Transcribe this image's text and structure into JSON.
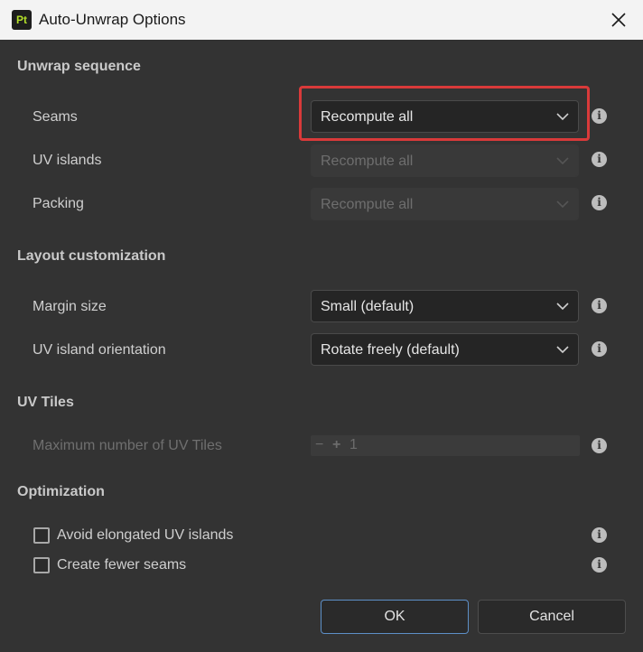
{
  "window": {
    "title": "Auto-Unwrap Options",
    "app_icon_text": "Pt"
  },
  "sections": {
    "unwrap": {
      "title": "Unwrap sequence",
      "seams": {
        "label": "Seams",
        "value": "Recompute all"
      },
      "uv_islands": {
        "label": "UV islands",
        "value": "Recompute all"
      },
      "packing": {
        "label": "Packing",
        "value": "Recompute all"
      }
    },
    "layout": {
      "title": "Layout customization",
      "margin": {
        "label": "Margin size",
        "value": "Small (default)"
      },
      "orientation": {
        "label": "UV island orientation",
        "value": "Rotate freely (default)"
      }
    },
    "uv_tiles": {
      "title": "UV Tiles",
      "max_tiles": {
        "label": "Maximum number of UV Tiles",
        "minus": "−",
        "plus": "+",
        "value": "1"
      }
    },
    "optimization": {
      "title": "Optimization",
      "avoid_elongated": {
        "label": "Avoid elongated UV islands",
        "checked": false
      },
      "fewer_seams": {
        "label": "Create fewer seams",
        "checked": false
      }
    }
  },
  "info_glyph": "i",
  "buttons": {
    "ok": "OK",
    "cancel": "Cancel"
  },
  "colors": {
    "highlight": "#d93a3a",
    "accent": "#5d8fc7",
    "app_icon_green": "#b4e02a"
  }
}
